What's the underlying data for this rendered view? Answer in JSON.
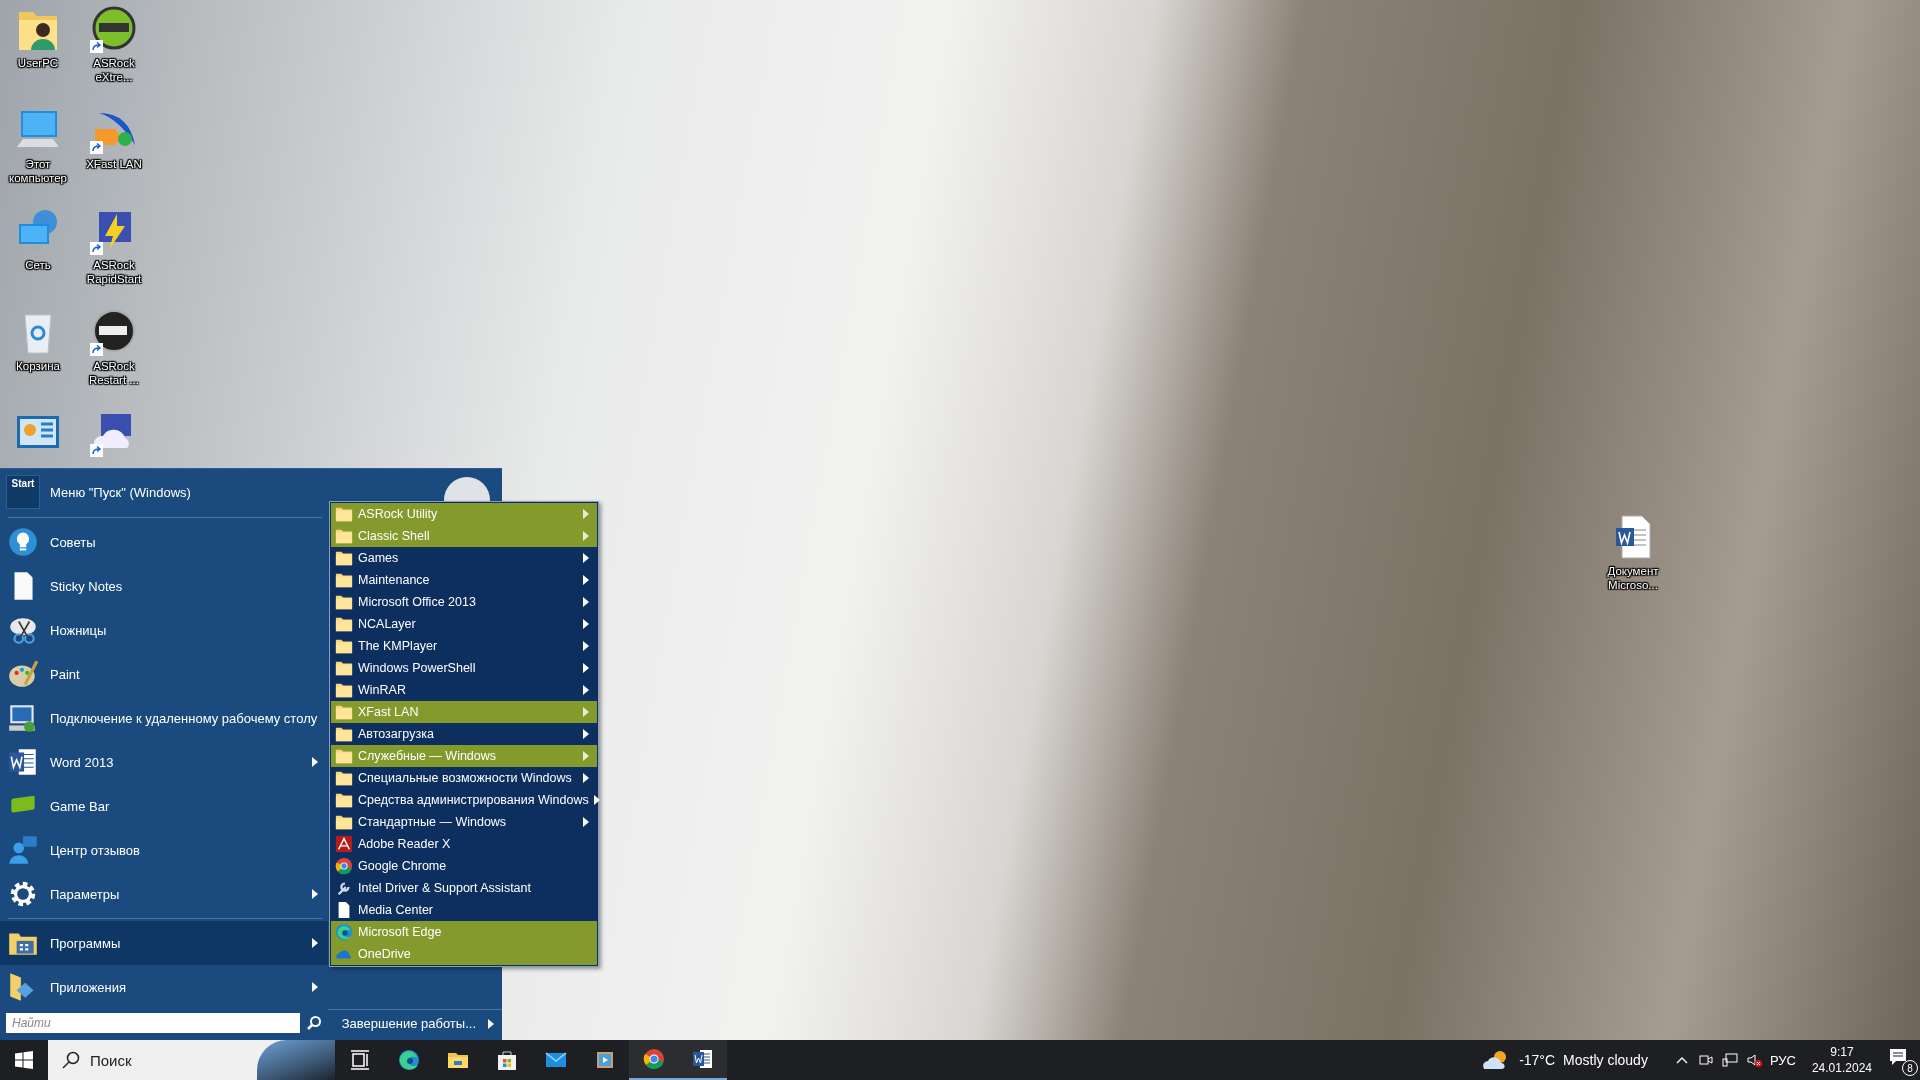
{
  "desktop": {
    "icons": [
      {
        "kind": "user-folder",
        "label": "UserPC",
        "shortcut": false
      },
      {
        "kind": "computer",
        "label": "Этот компьютер",
        "shortcut": false
      },
      {
        "kind": "network",
        "label": "Сеть",
        "shortcut": false
      },
      {
        "kind": "recycle-bin",
        "label": "Корзина",
        "shortcut": false
      },
      {
        "kind": "control-panel",
        "shortcut": false
      },
      {
        "kind": "disc-app",
        "label": "ASRock eXtre...",
        "shortcut": true
      },
      {
        "kind": "wing-app",
        "label": "XFast LAN",
        "shortcut": true
      },
      {
        "kind": "bolt-app",
        "label": "ASRock RapidStart",
        "shortcut": true
      },
      {
        "kind": "uefi-app",
        "label": "ASRock Restart ...",
        "shortcut": true
      },
      {
        "kind": "cloud-app",
        "shortcut": true
      }
    ],
    "document": {
      "label": "Документ Microso..."
    }
  },
  "start_menu": {
    "logo_text": "Start",
    "title": "Меню \"Пуск\" (Windows)",
    "items": [
      {
        "kind": "bulb",
        "label": "Советы",
        "has_submenu": false
      },
      {
        "kind": "note",
        "label": "Sticky Notes",
        "has_submenu": false
      },
      {
        "kind": "scissors",
        "label": "Ножницы",
        "has_submenu": false
      },
      {
        "kind": "palette",
        "label": "Paint",
        "has_submenu": false
      },
      {
        "kind": "remote",
        "label": "Подключение к удаленному рабочему столу",
        "has_submenu": false
      },
      {
        "kind": "word",
        "label": "Word 2013",
        "has_submenu": true
      },
      {
        "kind": "gamebar",
        "label": "Game Bar",
        "has_submenu": false
      },
      {
        "kind": "feedback",
        "label": "Центр отзывов",
        "has_submenu": false
      },
      {
        "kind": "gear",
        "label": "Параметры",
        "has_submenu": true
      }
    ],
    "bottom_items": [
      {
        "kind": "programs",
        "label": "Программы",
        "has_submenu": true,
        "selected": true
      },
      {
        "kind": "apps",
        "label": "Приложения",
        "has_submenu": true,
        "selected": false
      }
    ],
    "search": {
      "placeholder": "Найти"
    },
    "shutdown": {
      "label": "Завершение работы..."
    }
  },
  "programs_menu": [
    {
      "kind": "folder",
      "label": "ASRock Utility",
      "highlighted": true
    },
    {
      "kind": "folder",
      "label": "Classic Shell",
      "highlighted": true
    },
    {
      "kind": "folder",
      "label": "Games",
      "highlighted": false
    },
    {
      "kind": "folder",
      "label": "Maintenance",
      "highlighted": false
    },
    {
      "kind": "folder",
      "label": "Microsoft Office 2013",
      "highlighted": false
    },
    {
      "kind": "folder",
      "label": "NCALayer",
      "highlighted": false
    },
    {
      "kind": "folder",
      "label": "The KMPlayer",
      "highlighted": false
    },
    {
      "kind": "folder",
      "label": "Windows PowerShell",
      "highlighted": false
    },
    {
      "kind": "folder",
      "label": "WinRAR",
      "highlighted": false
    },
    {
      "kind": "folder",
      "label": "XFast LAN",
      "highlighted": true
    },
    {
      "kind": "folder",
      "label": "Автозагрузка",
      "highlighted": false
    },
    {
      "kind": "folder",
      "label": "Служебные — Windows",
      "highlighted": true
    },
    {
      "kind": "folder",
      "label": "Специальные возможности Windows",
      "highlighted": false
    },
    {
      "kind": "folder",
      "label": "Средства администрирования Windows",
      "highlighted": false
    },
    {
      "kind": "folder",
      "label": "Стандартные — Windows",
      "highlighted": false
    },
    {
      "kind": "pdf",
      "label": "Adobe Reader X",
      "highlighted": false
    },
    {
      "kind": "chrome",
      "label": "Google Chrome",
      "highlighted": false
    },
    {
      "kind": "tool",
      "label": "Intel Driver & Support Assistant",
      "highlighted": false
    },
    {
      "kind": "document",
      "label": "Media Center",
      "highlighted": false
    },
    {
      "kind": "edge",
      "label": "Microsoft Edge",
      "highlighted": true
    },
    {
      "kind": "cloud",
      "label": "OneDrive",
      "highlighted": true
    }
  ],
  "taskbar": {
    "search": {
      "placeholder": "Поиск"
    },
    "apps": [
      {
        "kind": "task-view",
        "running": false
      },
      {
        "kind": "edge",
        "running": false
      },
      {
        "kind": "explorer",
        "running": false
      },
      {
        "kind": "store",
        "running": false
      },
      {
        "kind": "mail",
        "running": false
      },
      {
        "kind": "media",
        "running": false
      },
      {
        "kind": "chrome",
        "running": true
      },
      {
        "kind": "word",
        "running": true
      }
    ],
    "weather": {
      "temperature": "-17°C",
      "condition": "Mostly cloudy"
    },
    "language": "РУС",
    "time": "9:17",
    "date": "24.01.2024",
    "notifications": "8"
  }
}
